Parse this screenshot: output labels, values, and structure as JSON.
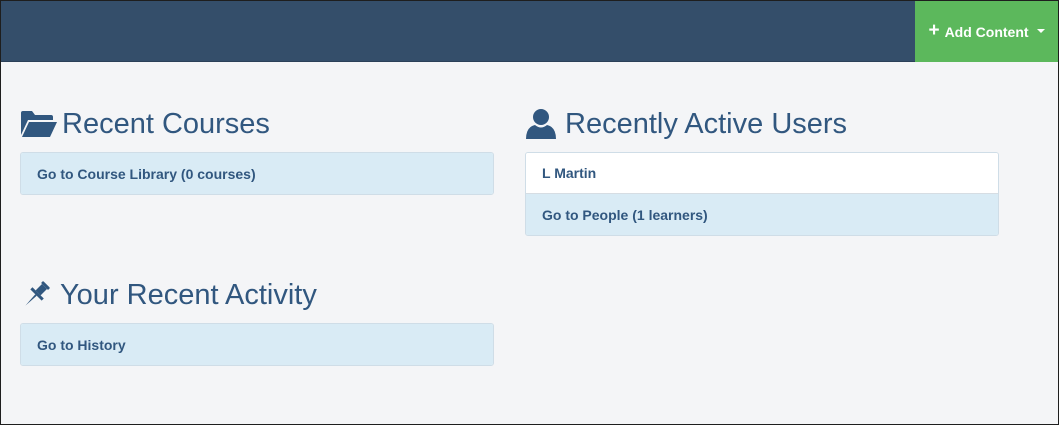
{
  "header": {
    "add_content_label": "Add Content"
  },
  "recent_courses": {
    "title": "Recent Courses",
    "icon": "folder-open-icon",
    "items": [
      {
        "label": "Go to Course Library (0 courses)"
      }
    ]
  },
  "recently_active_users": {
    "title": "Recently Active Users",
    "icon": "user-icon",
    "users": [
      {
        "name": "L Martin"
      }
    ],
    "link": {
      "label": "Go to People (1 learners)"
    }
  },
  "recent_activity": {
    "title": "Your Recent Activity",
    "icon": "pushpin-icon",
    "items": [
      {
        "label": "Go to History"
      }
    ]
  },
  "colors": {
    "topbar": "#344e6a",
    "accent_button": "#5cb85c",
    "heading": "#31577f",
    "list_item_bg": "#d9ebf5",
    "page_bg": "#f4f5f7"
  }
}
